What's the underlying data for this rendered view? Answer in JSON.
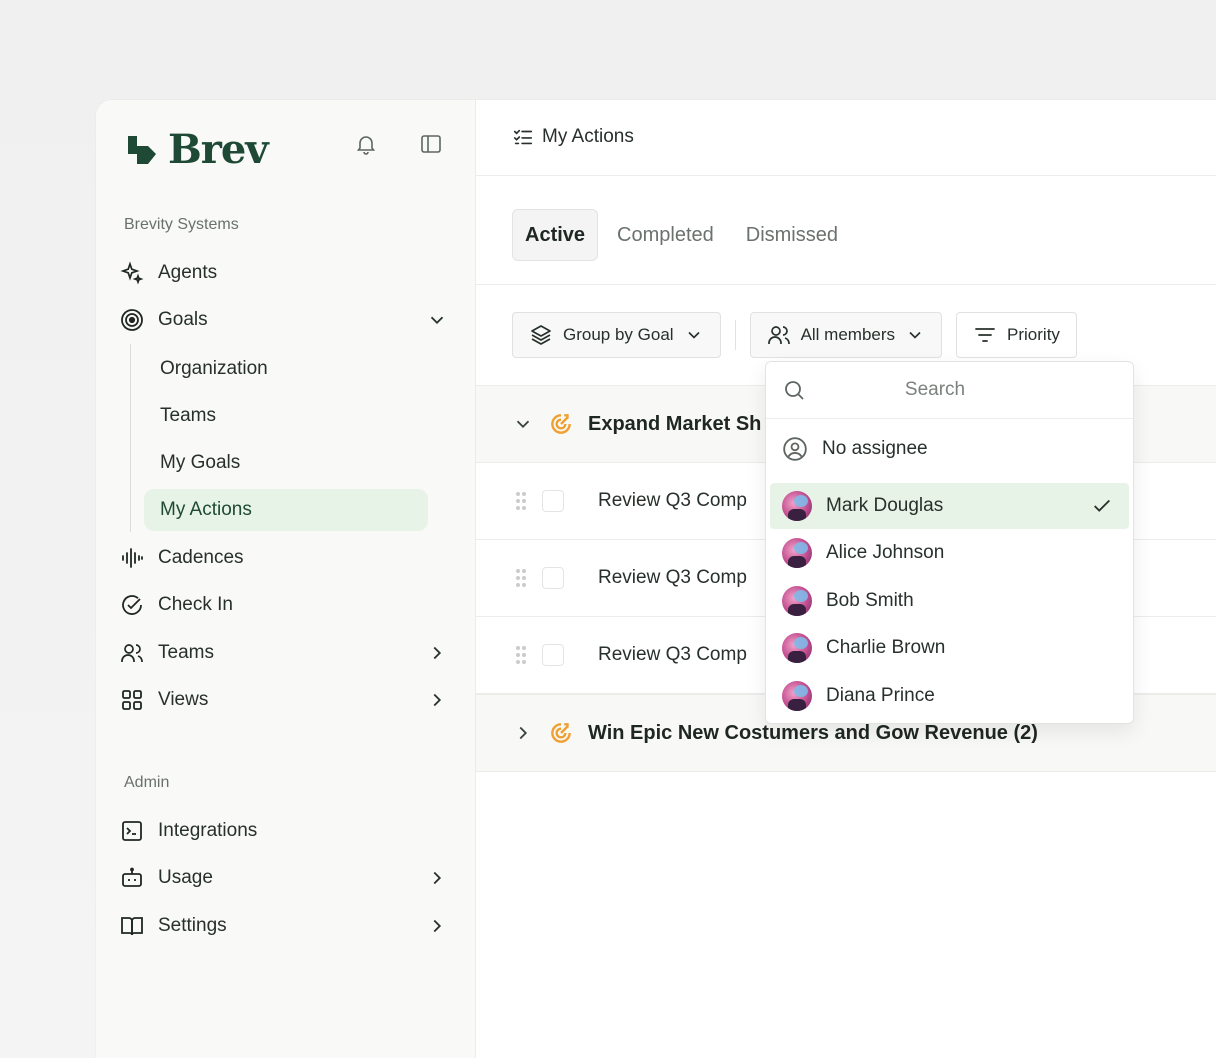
{
  "brand": {
    "name": "Brev",
    "color": "#1e4a35"
  },
  "sidebar": {
    "org_label": "Brevity Systems",
    "items": [
      {
        "label": "Agents",
        "icon": "sparkles-icon"
      },
      {
        "label": "Goals",
        "icon": "target-icon",
        "expanded": true
      },
      {
        "label": "Cadences",
        "icon": "waveform-icon"
      },
      {
        "label": "Check In",
        "icon": "check-circle-icon"
      },
      {
        "label": "Teams",
        "icon": "users-icon"
      },
      {
        "label": "Views",
        "icon": "grid-icon"
      }
    ],
    "goal_subitems": [
      "Organization",
      "Teams",
      "My Goals",
      "My Actions"
    ],
    "active_subitem": "My Actions",
    "admin_label": "Admin",
    "admin_items": [
      {
        "label": "Integrations",
        "icon": "terminal-icon"
      },
      {
        "label": "Usage",
        "icon": "bot-icon"
      },
      {
        "label": "Settings",
        "icon": "book-icon"
      }
    ]
  },
  "header": {
    "title": "My Actions"
  },
  "tabs": [
    {
      "label": "Active",
      "active": true
    },
    {
      "label": "Completed",
      "active": false
    },
    {
      "label": "Dismissed",
      "active": false
    }
  ],
  "filters": {
    "group_by": "Group by Goal",
    "members": "All members",
    "priority": "Priority"
  },
  "groups": [
    {
      "title": "Expand Market Sh",
      "expanded": true
    },
    {
      "title": "Win Epic New Costumers and Gow Revenue (2)",
      "expanded": false
    }
  ],
  "actions": [
    "Review Q3 Comp",
    "Review Q3 Comp",
    "Review Q3 Comp"
  ],
  "dropdown": {
    "search_placeholder": "Search",
    "no_assignee": "No assignee",
    "members": [
      {
        "name": "Mark Douglas",
        "selected": true
      },
      {
        "name": "Alice Johnson",
        "selected": false
      },
      {
        "name": "Bob Smith",
        "selected": false
      },
      {
        "name": "Charlie Brown",
        "selected": false
      },
      {
        "name": "Diana Prince",
        "selected": false
      }
    ]
  },
  "colors": {
    "accent_bg": "#e8f3e7",
    "goal_icon": "#f0a030"
  }
}
